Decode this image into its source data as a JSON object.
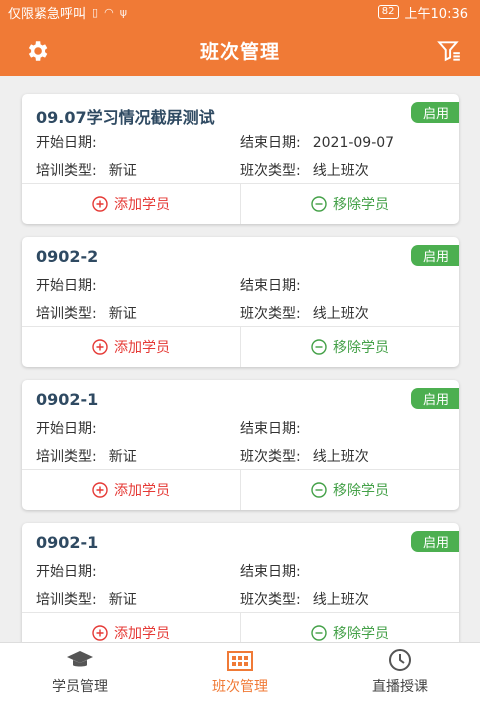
{
  "status_bar": {
    "carrier": "仅限紧急呼叫",
    "battery": "82",
    "time": "上午10:36"
  },
  "app_bar": {
    "title": "班次管理",
    "left_icon": "gear-icon",
    "right_icon": "filter-icon"
  },
  "labels": {
    "start_date": "开始日期:",
    "end_date": "结束日期:",
    "training_type": "培训类型:",
    "class_type": "班次类型:",
    "add_student": "添加学员",
    "remove_student": "移除学员"
  },
  "classes": [
    {
      "name": "09.07学习情况截屏测试",
      "status": "启用",
      "start_date": "",
      "end_date": "2021-09-07",
      "training_type": "新证",
      "class_type": "线上班次"
    },
    {
      "name": "0902-2",
      "status": "启用",
      "start_date": "",
      "end_date": "",
      "training_type": "新证",
      "class_type": "线上班次"
    },
    {
      "name": "0902-1",
      "status": "启用",
      "start_date": "",
      "end_date": "",
      "training_type": "新证",
      "class_type": "线上班次"
    },
    {
      "name": "0902-1",
      "status": "启用",
      "start_date": "",
      "end_date": "",
      "training_type": "新证",
      "class_type": "线上班次"
    }
  ],
  "tabs": [
    {
      "label": "学员管理",
      "icon": "graduation-cap-icon",
      "active": false
    },
    {
      "label": "班次管理",
      "icon": "building-icon",
      "active": true
    },
    {
      "label": "直播授课",
      "icon": "clock-icon",
      "active": false
    }
  ],
  "colors": {
    "primary": "#f07a36",
    "badge_green": "#4caf50",
    "add_red": "#e53935",
    "remove_green": "#43a047"
  }
}
